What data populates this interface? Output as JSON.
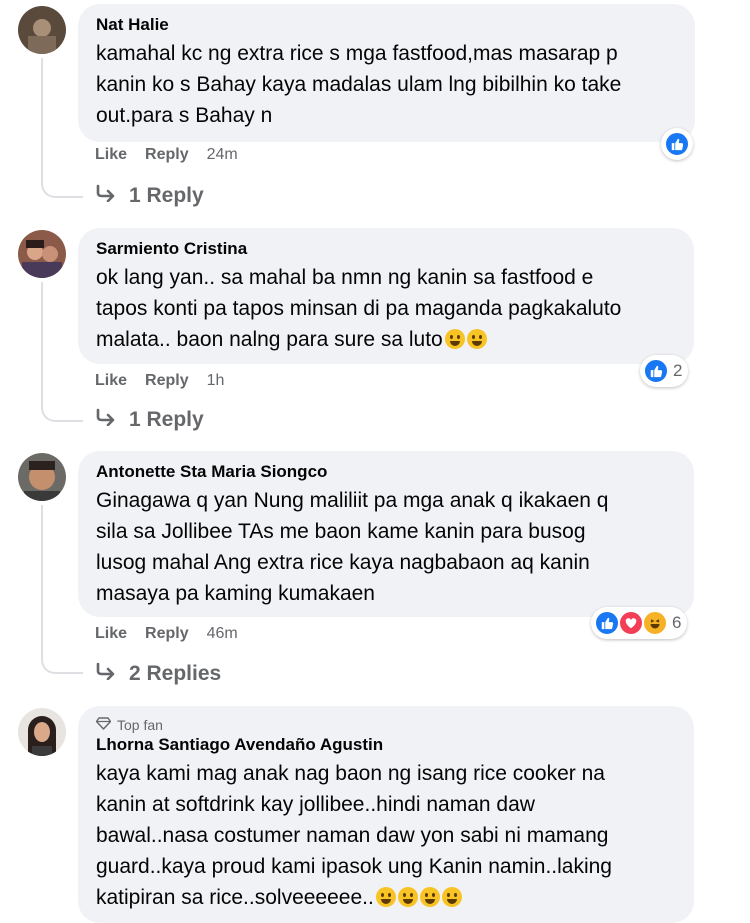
{
  "comments": [
    {
      "name": "Nat Halie",
      "lines": [
        "kamahal kc ng extra rice s mga fastfood,mas masarap p",
        "kanin ko s Bahay kaya madalas ulam lng bibilhin ko take",
        "out.para s Bahay n"
      ],
      "like": "Like",
      "reply": "Reply",
      "time": "24m",
      "reaction_count": "",
      "replies": "1 Reply"
    },
    {
      "name": "Sarmiento Cristina",
      "lines": [
        "ok lang yan.. sa mahal ba nmn ng kanin sa fastfood e",
        "tapos konti pa tapos minsan di pa maganda pagkakaluto",
        "malata.. baon nalng para sure sa luto"
      ],
      "like": "Like",
      "reply": "Reply",
      "time": "1h",
      "reaction_count": "2",
      "replies": "1 Reply"
    },
    {
      "name": "Antonette Sta Maria Siongco",
      "lines": [
        "Ginagawa q yan Nung maliliit pa mga anak q ikakaen q",
        "sila sa Jollibee TAs me baon kame kanin para busog",
        "lusog mahal Ang extra rice kaya nagbabaon aq kanin",
        "masaya pa kaming kumakaen"
      ],
      "like": "Like",
      "reply": "Reply",
      "time": "46m",
      "reaction_count": "6",
      "replies": "2 Replies"
    },
    {
      "badge": "Top fan",
      "name": "Lhorna Santiago Avendaño Agustin",
      "lines": [
        "kaya kami mag anak nag baon ng isang rice cooker na",
        "kanin at softdrink kay jollibee..hindi naman daw",
        "bawal..nasa costumer naman daw yon sabi ni mamang",
        "guard..kaya proud kami ipasok ung Kanin namin..laking",
        "katipiran sa rice..solveeeeee.."
      ]
    }
  ],
  "icons": {
    "like": "like-reaction-icon",
    "love": "love-reaction-icon",
    "haha": "haha-reaction-icon",
    "reply_arrow": "reply-arrow-icon",
    "diamond": "top-fan-diamond-icon"
  },
  "colors": {
    "bubble": "#f0f2f5",
    "secondary_text": "#65676b",
    "like_blue": "#1877f2",
    "love_red": "#f33e58",
    "haha_yellow": "#f7b125"
  }
}
